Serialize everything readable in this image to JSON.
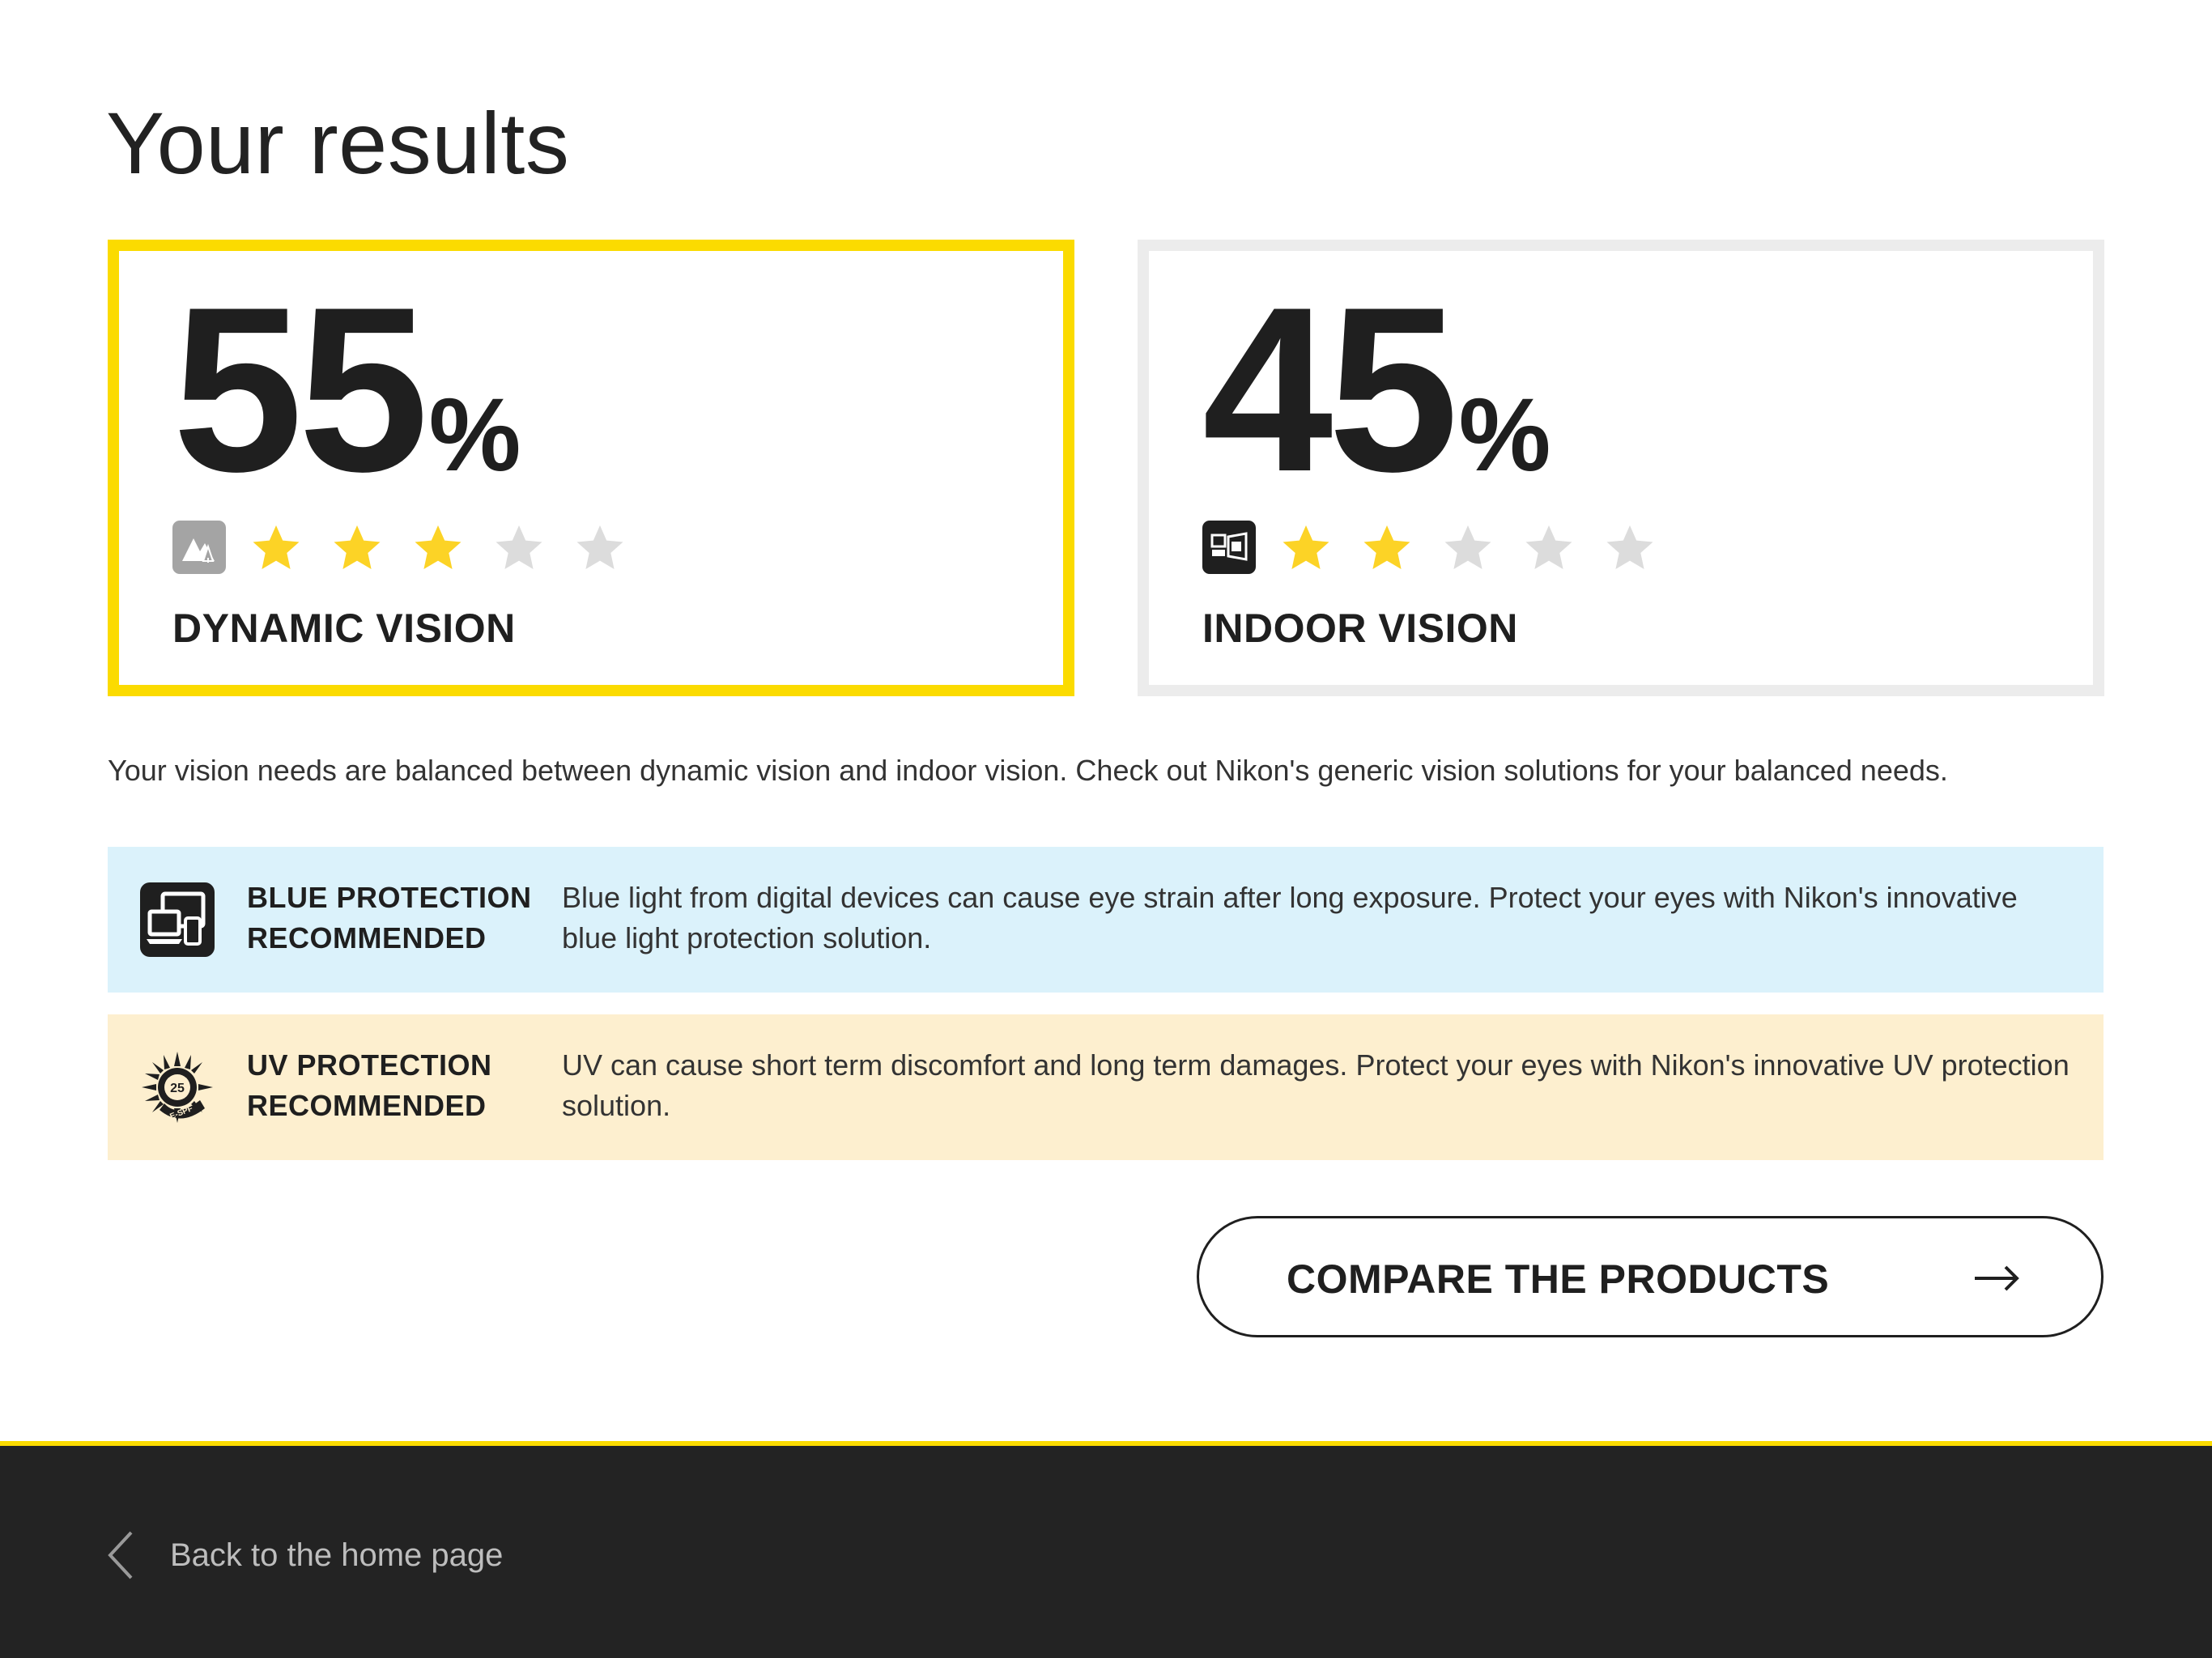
{
  "page": {
    "title": "Your results"
  },
  "results": [
    {
      "percent": "55",
      "percent_sign": "%",
      "label": "DYNAMIC VISION",
      "icon": "dynamic-vision-icon",
      "rating": 3,
      "max_rating": 5,
      "selected": true,
      "border_color": "#fbdb00"
    },
    {
      "percent": "45",
      "percent_sign": "%",
      "label": "INDOOR VISION",
      "icon": "indoor-vision-icon",
      "rating": 2,
      "max_rating": 5,
      "selected": false,
      "border_color": "#ececec"
    }
  ],
  "summary": "Your vision needs are balanced between dynamic vision and indoor vision. Check out Nikon's generic vision solutions for your balanced needs.",
  "recommendations": [
    {
      "icon": "blue-light-devices-icon",
      "title": "BLUE PROTECTION RECOMMENDED",
      "text": "Blue light from digital devices can cause eye strain after long exposure. Protect your eyes with Nikon's innovative blue light protection solution.",
      "background": "#dbf2fb"
    },
    {
      "icon": "uv-sun-icon",
      "title": "UV PROTECTION RECOMMENDED",
      "text": "UV can cause short term discomfort and long term damages. Protect your eyes with Nikon's innovative UV protection solution.",
      "background": "#fdefcf",
      "badge": {
        "number": "25",
        "text": "E-SPF"
      }
    }
  ],
  "cta": {
    "label": "COMPARE THE PRODUCTS",
    "icon": "arrow-right-icon"
  },
  "footer": {
    "back_label": "Back to the home page",
    "icon": "chevron-left-icon",
    "accent_color": "#fbdb00"
  },
  "colors": {
    "star_filled": "#fcd326",
    "star_empty": "#dcdcdc",
    "text": "#1f1f1f"
  }
}
